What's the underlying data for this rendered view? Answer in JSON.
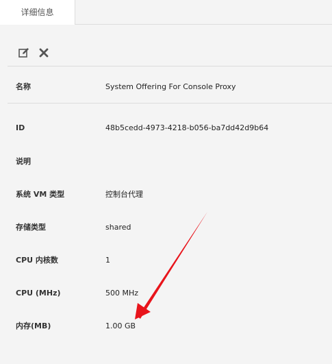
{
  "tabs": [
    {
      "label": "详细信息"
    }
  ],
  "toolbar": {
    "edit_icon": "edit-icon",
    "delete_icon": "close-icon"
  },
  "details": {
    "name": {
      "label": "名称",
      "value": "System Offering For Console Proxy"
    },
    "id": {
      "label": "ID",
      "value": "48b5cedd-4973-4218-b056-ba7dd42d9b64"
    },
    "description": {
      "label": "说明",
      "value": ""
    },
    "system_vm_type": {
      "label": "系统 VM 类型",
      "value": "控制台代理"
    },
    "storage_type": {
      "label": "存储类型",
      "value": "shared"
    },
    "cpu_cores": {
      "label": "CPU 内核数",
      "value": "1"
    },
    "cpu_mhz": {
      "label": "CPU (MHz)",
      "value": "500 MHz"
    },
    "memory": {
      "label": "内存(MB)",
      "value": "1.00 GB"
    }
  },
  "colors": {
    "background": "#f4f4f4",
    "tab_active": "#ffffff",
    "divider": "#dcdcdc",
    "annotation_arrow": "#e8141b"
  }
}
